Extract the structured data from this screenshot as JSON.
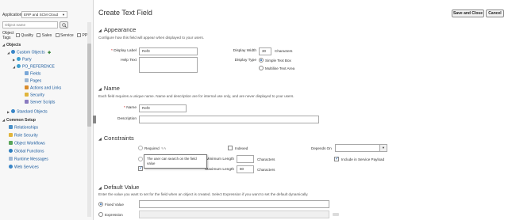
{
  "sidebar": {
    "application_label": "Application",
    "application_value": "ERP and SCM Cloud",
    "search_placeholder": "Object name",
    "object_tags_label": "Object\nTags",
    "tags": [
      "Quality",
      "Sales",
      "Service",
      "PP"
    ],
    "objects_header": "Objects",
    "tree": [
      {
        "label": "Custom Objects",
        "icon": "custom-objects-icon"
      },
      {
        "label": "Party",
        "icon": "object-icon"
      },
      {
        "label": "PO_REFERENCE",
        "icon": "object-icon"
      },
      {
        "label": "Fields",
        "icon": "fields-icon"
      },
      {
        "label": "Pages",
        "icon": "pages-icon"
      },
      {
        "label": "Actions and Links",
        "icon": "actions-icon"
      },
      {
        "label": "Security",
        "icon": "security-icon"
      },
      {
        "label": "Server Scripts",
        "icon": "scripts-icon"
      },
      {
        "label": "Standard Objects",
        "icon": "standard-objects-icon"
      }
    ],
    "common_setup_header": "Common Setup",
    "common_setup": [
      {
        "label": "Relationships",
        "icon": "relationships-icon"
      },
      {
        "label": "Role Security",
        "icon": "role-security-icon"
      },
      {
        "label": "Object Workflows",
        "icon": "workflows-icon"
      },
      {
        "label": "Global Functions",
        "icon": "global-functions-icon"
      },
      {
        "label": "Runtime Messages",
        "icon": "messages-icon"
      },
      {
        "label": "Web Services",
        "icon": "web-services-icon"
      }
    ]
  },
  "header": {
    "title": "Create Text Field",
    "save_close": "Save and Close",
    "cancel": "Cancel"
  },
  "appearance": {
    "title": "Appearance",
    "desc": "Configure how this field will appear when displayed to your users.",
    "display_label_label": "Display Label",
    "display_label_value": "Ref3",
    "help_text_label": "Help Text",
    "display_width_label": "Display Width",
    "display_width_value": "30",
    "characters": "Characters",
    "display_type_label": "Display Type",
    "display_type_options": [
      "Simple Text Box",
      "Multiline Text Area"
    ]
  },
  "name_section": {
    "title": "Name",
    "desc": "Each field requires a unique name. Name and description are for internal use only, and are never displayed to your users.",
    "name_label": "Name",
    "name_value": "Ref3",
    "description_label": "Description"
  },
  "constraints": {
    "title": "Constraints",
    "required_label": "Required",
    "indexed_label": "Indexed",
    "depends_on_label": "Depends On",
    "min_length_label": "Minimum Length",
    "max_length_label": "Maximum Length",
    "max_length_value": "80",
    "characters": "Characters",
    "include_service_payload": "Include in Service Payload",
    "tooltip": "The user can search on the field value"
  },
  "default_value": {
    "title": "Default Value",
    "desc": "Enter the value you want to set for the field when an object is created. Select Expression if you want to set the default dynamically.",
    "fixed_value_label": "Fixed Value",
    "expression_label": "Expression"
  },
  "colors": {
    "accent": "#1f5fa8",
    "link": "#14569b",
    "sidebar_bg": "#f7f7f7"
  }
}
